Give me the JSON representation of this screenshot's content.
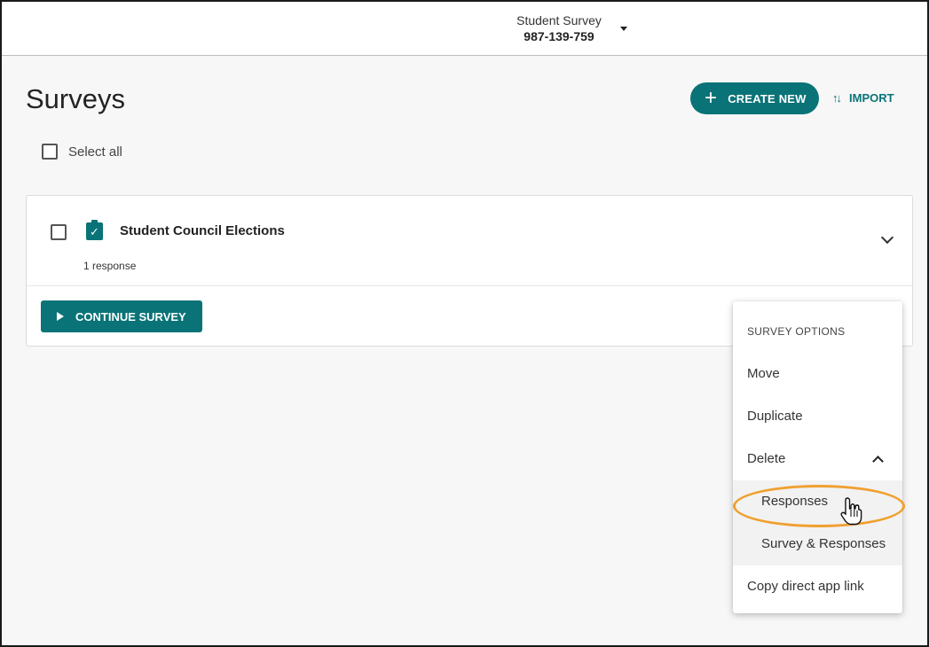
{
  "header": {
    "project_name": "Student Survey",
    "project_code": "987-139-759"
  },
  "page": {
    "title": "Surveys",
    "create_new_label": "CREATE NEW",
    "import_label": "IMPORT",
    "select_all_label": "Select all"
  },
  "survey": {
    "title": "Student Council Elections",
    "responses": "1 response",
    "continue_label": "CONTINUE SURVEY"
  },
  "menu": {
    "header": "SURVEY OPTIONS",
    "move": "Move",
    "duplicate": "Duplicate",
    "delete": "Delete",
    "delete_responses": "Responses",
    "delete_survey_responses": "Survey & Responses",
    "copy_link": "Copy direct app link"
  },
  "colors": {
    "accent": "#0a7377",
    "highlight": "#f0a030"
  },
  "icons": [
    "chevron-down-icon",
    "plus-icon",
    "swap-icon",
    "clipboard-check-icon",
    "play-icon",
    "chevron-up-icon",
    "hand-cursor-icon"
  ]
}
